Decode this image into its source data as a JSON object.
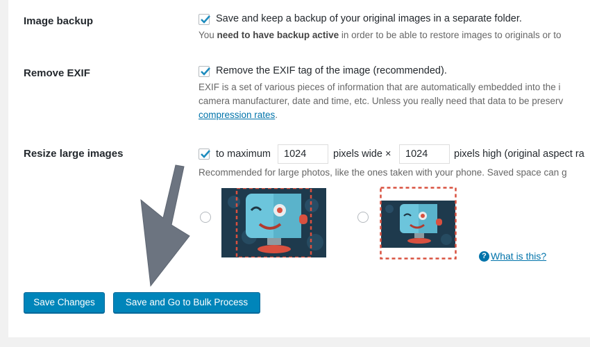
{
  "settings": {
    "image_backup": {
      "label": "Image backup",
      "checkbox_label": "Save and keep a backup of your original images in a separate folder.",
      "desc_pre": "You ",
      "desc_bold": "need to have backup active",
      "desc_post": " in order to be able to restore images to originals or to"
    },
    "remove_exif": {
      "label": "Remove EXIF",
      "checkbox_label": "Remove the EXIF tag of the image (recommended).",
      "desc_line1": "EXIF is a set of various pieces of information that are automatically embedded into the i",
      "desc_line2": "camera manufacturer, date and time, etc. Unless you really need that data to be preserv",
      "desc_link": "compression rates",
      "desc_link_suffix": "."
    },
    "resize": {
      "label": "Resize large images",
      "to_maximum": "to maximum",
      "width_value": "1024",
      "pixels_wide": "pixels wide ×",
      "height_value": "1024",
      "pixels_high": "pixels high (original aspect ra",
      "desc": "Recommended for large photos, like the ones taken with your phone. Saved space can g",
      "help_link": "What is this?",
      "help_icon": "?"
    }
  },
  "buttons": {
    "save_changes": "Save Changes",
    "save_bulk": "Save and Go to Bulk Process"
  },
  "icons": {
    "checkbox": "checkmark-icon",
    "help": "question-circle-icon",
    "arrow": "arrow-annotation-icon"
  },
  "colors": {
    "primary_button": "#0085ba",
    "checkmark": "#1e8cbe",
    "link": "#0073aa",
    "arrow": "#6c7480",
    "crop_border": "#d9503f"
  }
}
